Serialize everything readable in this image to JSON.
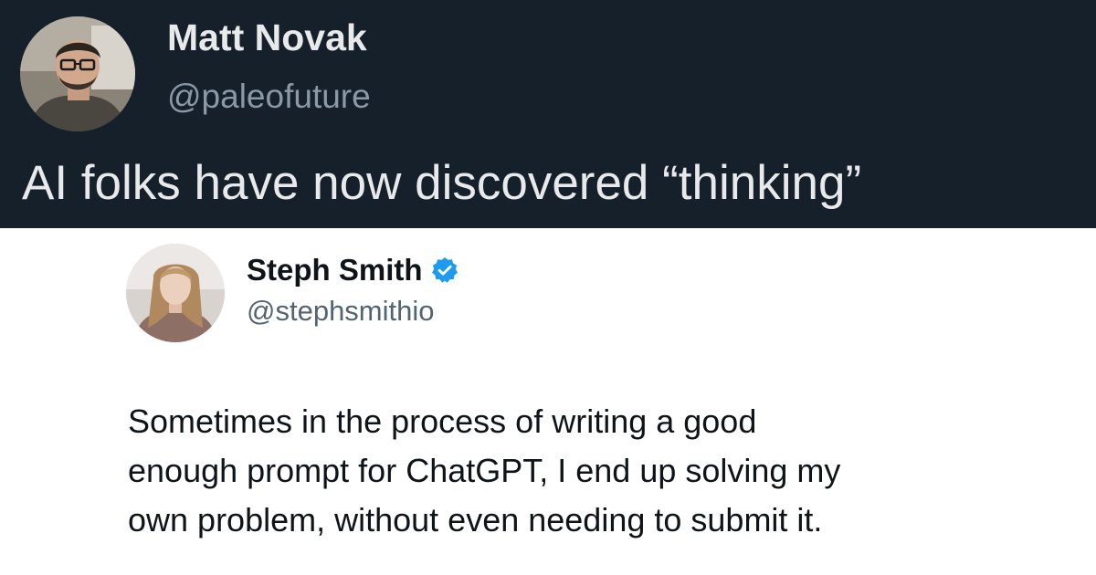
{
  "outer_tweet": {
    "avatar_icon": "profile-photo-man-glasses",
    "display_name": "Matt Novak",
    "handle": "@paleofuture",
    "text": "AI folks have now discovered “thinking”",
    "colors": {
      "background": "#15202b",
      "name": "#e7e9ea",
      "handle": "#8b98a5"
    }
  },
  "quoted_tweet": {
    "avatar_icon": "profile-photo-woman",
    "display_name": "Steph Smith",
    "verified_icon": "verified-badge-icon",
    "handle": "@stephsmithio",
    "text": "Sometimes in the process of writing a good\nenough prompt for ChatGPT, I end up solving my\nown problem, without even needing to submit it.",
    "colors": {
      "background": "#ffffff",
      "verified": "#1d9bf0",
      "handle": "#536471"
    }
  }
}
